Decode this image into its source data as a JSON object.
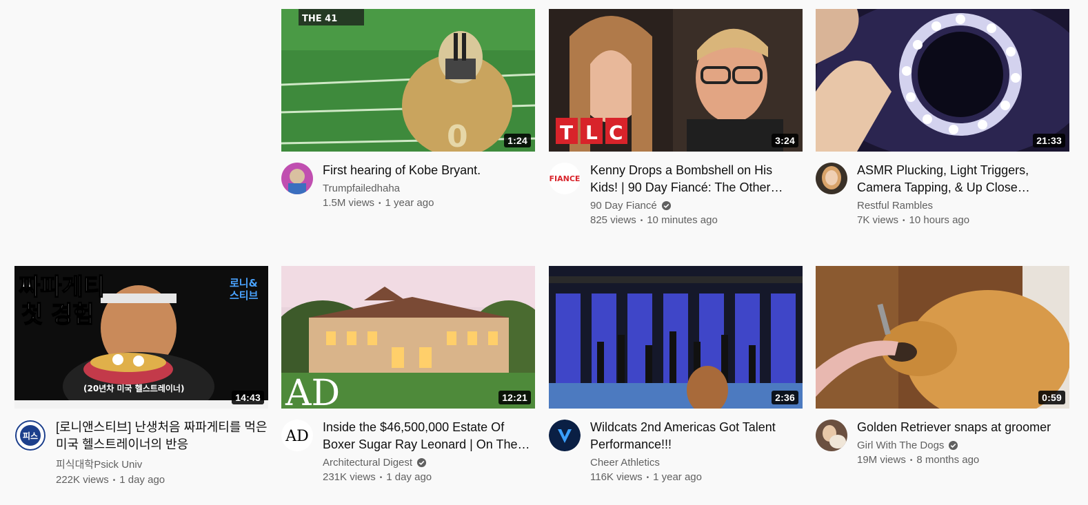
{
  "videos": [
    {
      "title": "First hearing of Kobe Bryant.",
      "channel": "Trumpfailedhaha",
      "verified": false,
      "views": "1.5M views",
      "age": "1 year ago",
      "duration": "1:24",
      "overlay_text": "THE 41",
      "avatar_color": "#b04aa8"
    },
    {
      "title": "Kenny Drops a Bombshell on His Kids! | 90 Day Fiancé: The Other…",
      "channel": "90 Day Fiancé",
      "verified": true,
      "views": "825 views",
      "age": "10 minutes ago",
      "duration": "3:24",
      "overlay_text": "TLC",
      "avatar_text": "FIANCE",
      "avatar_color": "#ffffff"
    },
    {
      "title": "ASMR Plucking, Light Triggers, Camera Tapping, & Up Close…",
      "channel": "Restful Rambles",
      "verified": false,
      "views": "7K views",
      "age": "10 hours ago",
      "duration": "21:33",
      "avatar_color": "#c9a07a"
    },
    {
      "title": "[로니앤스티브] 난생처음 짜파게티를 먹은 미국 헬스트레이너의 반응",
      "channel": "피식대학Psick Univ",
      "verified": false,
      "views": "222K views",
      "age": "1 day ago",
      "duration": "14:43",
      "overlay_text": "짜파게티 첫 경험",
      "overlay_badge": "로니& 스티브",
      "overlay_caption": "(20년차 미국 헬스트레이너)",
      "avatar_text": "피스",
      "avatar_color": "#1c3f8c"
    },
    {
      "title": "Inside the $46,500,000 Estate Of Boxer Sugar Ray Leonard | On The…",
      "channel": "Architectural Digest",
      "verified": true,
      "views": "231K views",
      "age": "1 day ago",
      "duration": "12:21",
      "overlay_text": "AD",
      "avatar_text": "AD",
      "avatar_color": "#ffffff"
    },
    {
      "title": "Wildcats 2nd Americas Got Talent Performance!!!",
      "channel": "Cheer Athletics",
      "verified": false,
      "views": "116K views",
      "age": "1 year ago",
      "duration": "2:36",
      "avatar_color": "#0a1f44"
    },
    {
      "title": "Golden Retriever snaps at groomer",
      "channel": "Girl With The Dogs",
      "verified": true,
      "views": "19M views",
      "age": "8 months ago",
      "duration": "0:59",
      "avatar_color": "#8a6b52"
    }
  ]
}
